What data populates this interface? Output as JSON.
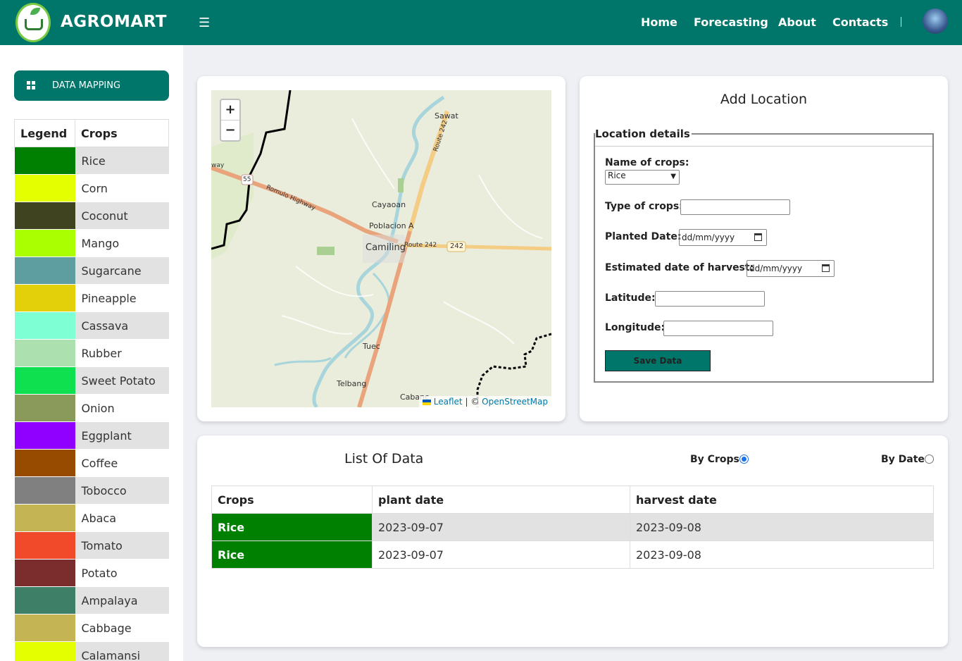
{
  "header": {
    "brand": "AGROMART",
    "nav": [
      {
        "label": "Home"
      },
      {
        "label": "Forecasting"
      },
      {
        "label": "About"
      },
      {
        "label": "Contacts"
      }
    ]
  },
  "sidebar": {
    "button_label": "DATA MAPPING",
    "legend_header": "Legend",
    "crops_header": "Crops",
    "crops": [
      {
        "name": "Rice",
        "color": "#008000"
      },
      {
        "name": "Corn",
        "color": "#e4ff00"
      },
      {
        "name": "Coconut",
        "color": "#3f4320"
      },
      {
        "name": "Mango",
        "color": "#aaff00"
      },
      {
        "name": "Sugarcane",
        "color": "#5f9ea0"
      },
      {
        "name": "Pineapple",
        "color": "#e4d00a"
      },
      {
        "name": "Cassava",
        "color": "#7fffd4"
      },
      {
        "name": "Rubber",
        "color": "#ace1af"
      },
      {
        "name": "Sweet Potato",
        "color": "#0fe04f"
      },
      {
        "name": "Onion",
        "color": "#8a9a5b"
      },
      {
        "name": "Eggplant",
        "color": "#8f00ff"
      },
      {
        "name": "Coffee",
        "color": "#964b00"
      },
      {
        "name": "Tobocco",
        "color": "#808080"
      },
      {
        "name": "Abaca",
        "color": "#c4b454"
      },
      {
        "name": "Tomato",
        "color": "#f04a2a"
      },
      {
        "name": "Potato",
        "color": "#7b2d2d"
      },
      {
        "name": "Ampalaya",
        "color": "#3e8067"
      },
      {
        "name": "Cabbage",
        "color": "#c4b454"
      },
      {
        "name": "Calamansi",
        "color": "#e4ff00"
      }
    ]
  },
  "map": {
    "zoom_in": "+",
    "zoom_out": "−",
    "labels": {
      "sawat": "Sawat",
      "cayaoan": "Cayaoan",
      "poblacion": "Poblacion A",
      "camiling": "Camiling",
      "route242": "Route 242",
      "badge242": "242",
      "romulo": "Romulo Highway",
      "tuec": "Tuec",
      "telbang": "Telbang",
      "cabanc": "Cabanc",
      "route242v": "Route 242",
      "badge55": "55",
      "way": "way"
    },
    "attribution": {
      "leaflet": "Leaflet",
      "sep": "| ©",
      "osm": "OpenStreetMap"
    }
  },
  "form": {
    "title": "Add Location",
    "legend": "Location details",
    "name_label": "Name of crops:",
    "name_value": "Rice",
    "type_label": "Type of crops:",
    "planted_label": "Planted Date:",
    "harvest_label": "Estimated date of harvest:",
    "date_placeholder": "dd/mm/yyyy",
    "lat_label": "Latitude:",
    "lng_label": "Longitude:",
    "save_label": "Save Data"
  },
  "list": {
    "title": "List Of Data",
    "by_crops": "By Crops",
    "by_date": "By Date",
    "columns": [
      "Crops",
      "plant date",
      "harvest date"
    ],
    "rows": [
      {
        "crop": "Rice",
        "plant": "2023-09-07",
        "harvest": "2023-09-08"
      },
      {
        "crop": "Rice",
        "plant": "2023-09-07",
        "harvest": "2023-09-08"
      }
    ]
  }
}
